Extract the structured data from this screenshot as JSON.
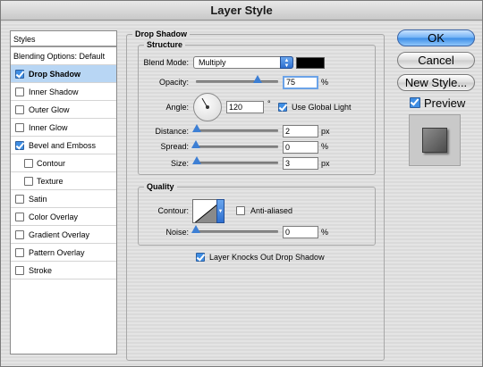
{
  "window": {
    "title": "Layer Style"
  },
  "styles_list": {
    "header": "Styles",
    "items": [
      {
        "label": "Blending Options: Default",
        "checkbox": false,
        "checked": false,
        "selected": false,
        "indent": 0
      },
      {
        "label": "Drop Shadow",
        "checkbox": true,
        "checked": true,
        "selected": true,
        "indent": 0
      },
      {
        "label": "Inner Shadow",
        "checkbox": true,
        "checked": false,
        "selected": false,
        "indent": 0
      },
      {
        "label": "Outer Glow",
        "checkbox": true,
        "checked": false,
        "selected": false,
        "indent": 0
      },
      {
        "label": "Inner Glow",
        "checkbox": true,
        "checked": false,
        "selected": false,
        "indent": 0
      },
      {
        "label": "Bevel and Emboss",
        "checkbox": true,
        "checked": true,
        "selected": false,
        "indent": 0
      },
      {
        "label": "Contour",
        "checkbox": true,
        "checked": false,
        "selected": false,
        "indent": 1
      },
      {
        "label": "Texture",
        "checkbox": true,
        "checked": false,
        "selected": false,
        "indent": 1
      },
      {
        "label": "Satin",
        "checkbox": true,
        "checked": false,
        "selected": false,
        "indent": 0
      },
      {
        "label": "Color Overlay",
        "checkbox": true,
        "checked": false,
        "selected": false,
        "indent": 0
      },
      {
        "label": "Gradient Overlay",
        "checkbox": true,
        "checked": false,
        "selected": false,
        "indent": 0
      },
      {
        "label": "Pattern Overlay",
        "checkbox": true,
        "checked": false,
        "selected": false,
        "indent": 0
      },
      {
        "label": "Stroke",
        "checkbox": true,
        "checked": false,
        "selected": false,
        "indent": 0
      }
    ]
  },
  "drop_shadow": {
    "title": "Drop Shadow",
    "structure": {
      "title": "Structure",
      "blend_mode_label": "Blend Mode:",
      "blend_mode_value": "Multiply",
      "shadow_color": "#000000",
      "opacity_label": "Opacity:",
      "opacity_value": "75",
      "opacity_level": 0.75,
      "opacity_unit": "%",
      "angle_label": "Angle:",
      "angle_value": "120",
      "angle_unit": "°",
      "use_global_light_label": "Use Global Light",
      "use_global_light_checked": true,
      "distance_label": "Distance:",
      "distance_value": "2",
      "distance_unit": "px",
      "spread_label": "Spread:",
      "spread_value": "0",
      "spread_unit": "%",
      "size_label": "Size:",
      "size_value": "3",
      "size_unit": "px"
    },
    "quality": {
      "title": "Quality",
      "contour_label": "Contour:",
      "anti_aliased_label": "Anti-aliased",
      "anti_aliased_checked": false,
      "noise_label": "Noise:",
      "noise_value": "0",
      "noise_unit": "%"
    },
    "knocks_out_label": "Layer Knocks Out Drop Shadow",
    "knocks_out_checked": true
  },
  "buttons": {
    "ok": "OK",
    "cancel": "Cancel",
    "new_style": "New Style..."
  },
  "preview": {
    "label": "Preview",
    "checked": true
  },
  "colors": {
    "accent": "#3b8de6",
    "selection": "#b8d6f4"
  }
}
